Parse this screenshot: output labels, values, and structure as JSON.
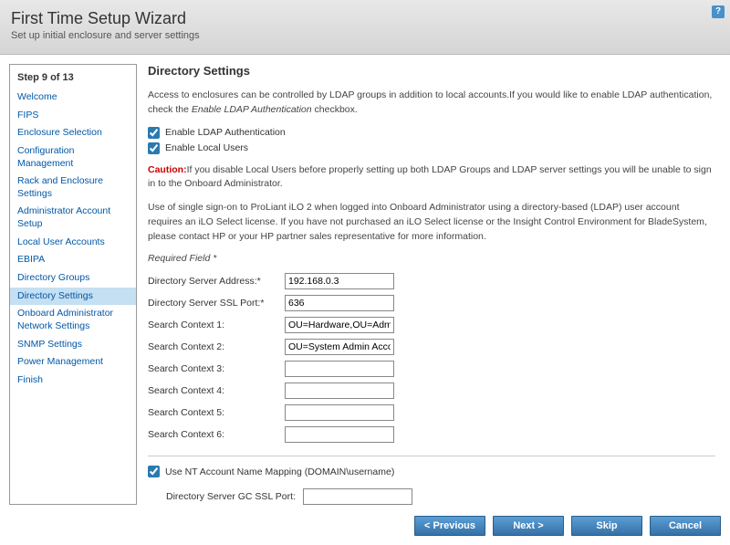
{
  "header": {
    "title": "First Time Setup Wizard",
    "subtitle": "Set up initial enclosure and server settings",
    "help": "?"
  },
  "sidebar": {
    "step_label": "Step 9 of 13",
    "items": [
      "Welcome",
      "FIPS",
      "Enclosure Selection",
      "Configuration Management",
      "Rack and Enclosure Settings",
      "Administrator Account Setup",
      "Local User Accounts",
      "EBIPA",
      "Directory Groups",
      "Directory Settings",
      "Onboard Administrator Network Settings",
      "SNMP Settings",
      "Power Management",
      "Finish"
    ]
  },
  "main": {
    "heading": "Directory Settings",
    "intro_a": "Access to enclosures can be controlled by LDAP groups in addition to local accounts.If you would like to enable LDAP authentication, check the ",
    "intro_em": "Enable LDAP Authentication",
    "intro_b": " checkbox.",
    "cb_ldap": "Enable LDAP Authentication",
    "cb_local": "Enable Local Users",
    "caution_label": "Caution:",
    "caution_text": "If you disable Local Users before properly setting up both LDAP Groups and LDAP server settings you will be unable to sign in to the Onboard Administrator.",
    "sso_text": "Use of single sign-on to ProLiant iLO 2 when logged into Onboard Administrator using a directory-based (LDAP) user account requires an iLO Select license. If you have not purchased an iLO Select license or the Insight Control Environment for BladeSystem, please contact HP or your HP partner sales representative for more information.",
    "required": "Required Field *",
    "fields": {
      "addr_label": "Directory Server Address:*",
      "addr_value": "192.168.0.3",
      "ssl_label": "Directory Server SSL Port:*",
      "ssl_value": "636",
      "sc1_label": "Search Context 1:",
      "sc1_value": "OU=Hardware,OU=Admin",
      "sc2_label": "Search Context 2:",
      "sc2_value": "OU=System Admin Accou",
      "sc3_label": "Search Context 3:",
      "sc3_value": "",
      "sc4_label": "Search Context 4:",
      "sc4_value": "",
      "sc5_label": "Search Context 5:",
      "sc5_value": "",
      "sc6_label": "Search Context 6:",
      "sc6_value": ""
    },
    "nt_label": "Use NT Account Name Mapping (DOMAIN\\username)",
    "gc_label": "Directory Server GC SSL Port:",
    "gc_value": ""
  },
  "footer": {
    "prev": "< Previous",
    "next": "Next >",
    "skip": "Skip",
    "cancel": "Cancel"
  }
}
